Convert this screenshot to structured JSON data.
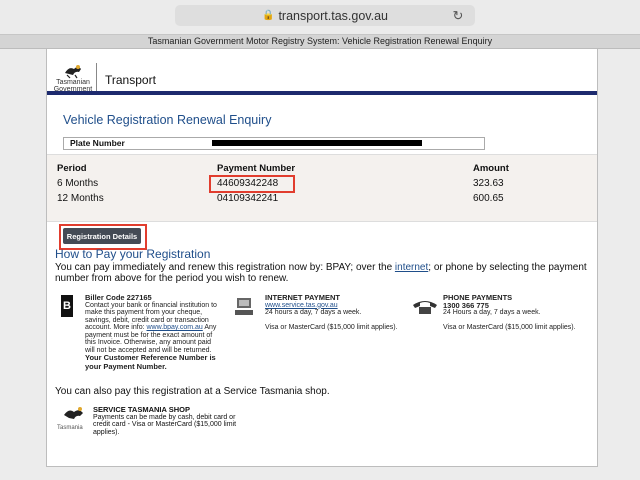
{
  "browser": {
    "url": "transport.tas.gov.au",
    "tab_title": "Tasmanian Government Motor Registry System: Vehicle Registration Renewal Enquiry"
  },
  "header": {
    "logo_text_top": "Tasmanian",
    "logo_text_bottom": "Government",
    "section": "Transport"
  },
  "enquiry": {
    "title": "Vehicle Registration Renewal Enquiry",
    "plate_label": "Plate Number"
  },
  "table": {
    "headers": [
      "Period",
      "Payment Number",
      "Amount"
    ],
    "rows": [
      {
        "period": "6 Months",
        "payment_number": "44609342248",
        "amount": "323.63"
      },
      {
        "period": "12 Months",
        "payment_number": "04109342241",
        "amount": "600.65"
      }
    ]
  },
  "buttons": {
    "registration_details": "Registration Details"
  },
  "how_to_pay": {
    "title": "How to Pay your Registration",
    "text_before": "You can pay immediately and renew this registration now by: BPAY; over the ",
    "link": "internet",
    "text_after": "; or phone by selecting the payment number from above for the period you wish to renew."
  },
  "bpay": {
    "heading": "Biller Code 227165",
    "text": "Contact your bank or financial institution to make this payment from your cheque, savings, debit, credit card or transaction account. More info: ",
    "link": "www.bpay.com.au",
    "text2": " Any payment must be for the exact amount of this Invoice. Otherwise, any amount paid will not be accepted and will be returned.",
    "ref": "Your Customer Reference Number is your Payment Number."
  },
  "internet": {
    "heading": "INTERNET PAYMENT",
    "link": "www.service.tas.gov.au",
    "line1": "24 hours a day, 7 days a week.",
    "line2": "Visa or MasterCard ($15,000 limit applies)."
  },
  "phone": {
    "heading": "PHONE PAYMENTS",
    "number": "1300 366 775",
    "line1": "24 Hours a day, 7 days a week.",
    "line2": "Visa or MasterCard ($15,000 limit applies)."
  },
  "also": "You can also pay this registration at a Service Tasmania shop.",
  "shop": {
    "heading": "SERVICE TASMANIA SHOP",
    "text": "Payments can be made by cash, debit card or credit card - Visa or MasterCard ($15,000 limit applies).",
    "logo_label": "Tasmania"
  }
}
